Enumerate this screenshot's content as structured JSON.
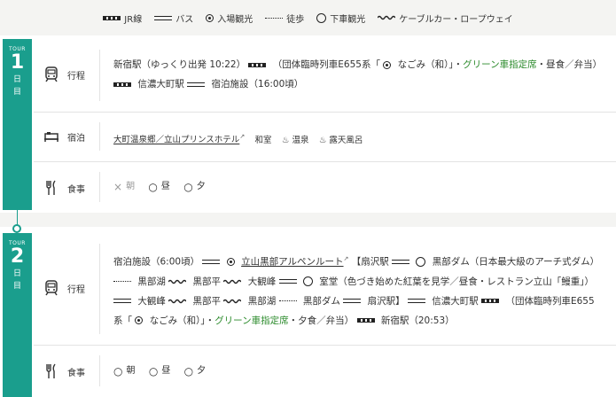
{
  "legend": [
    {
      "icon": "jr-line-icon",
      "label": "JR線"
    },
    {
      "icon": "bus-line-icon",
      "label": "バス"
    },
    {
      "icon": "entry-sightseeing-icon",
      "label": "入場観光"
    },
    {
      "icon": "walk-line-icon",
      "label": "徒歩"
    },
    {
      "icon": "stopover-sightseeing-icon",
      "label": "下車観光"
    },
    {
      "icon": "cable-car-icon",
      "label": "ケーブルカー・ロープウェイ"
    }
  ],
  "day1": {
    "tour": "TOUR",
    "num": "1",
    "ch1": "日",
    "ch2": "目",
    "itinerary": {
      "label": "行程",
      "t1": "新宿駅（ゆっくり出発 10:22）",
      "t2": "（団体臨時列車E655系「",
      "t3": "なごみ（和）」・",
      "t4": "グリーン車指定席",
      "t5": "・昼食／弁当）",
      "t6": "信濃大町駅",
      "t7": "宿泊施設（16:00頃）"
    },
    "lodging": {
      "label": "宿泊",
      "hotel": "大町温泉郷／立山プリンスホテル",
      "room": "和室",
      "onsen": "温泉",
      "outdoor": "露天風呂"
    },
    "meals": {
      "label": "食事",
      "breakfast": "朝",
      "lunch": "昼",
      "dinner": "夕",
      "breakfast_mark": "×",
      "lunch_mark": "○",
      "dinner_mark": "○"
    }
  },
  "day2": {
    "tour": "TOUR",
    "num": "2",
    "ch1": "日",
    "ch2": "目",
    "itinerary": {
      "label": "行程",
      "t1": "宿泊施設（6:00頃）",
      "t2": "立山黒部アルペンルート",
      "t3": "【扇沢駅",
      "t4": "黒部ダム（日本最大級のアーチ式ダム）",
      "t5": "黒部湖",
      "t6": "黒部平",
      "t7": "大観峰",
      "t8": "室堂（色づき始めた紅葉を見学／昼食・レストラン立山「鰻重」）",
      "t9": "大観峰",
      "t10": "黒部平",
      "t11": "黒部湖",
      "t12": "黒部ダム",
      "t13": "扇沢駅】",
      "t14": "信濃大町駅",
      "t15": "（団体臨時列車E655系「",
      "t16": "なごみ（和）」・",
      "t17": "グリーン車指定席",
      "t18": "・夕食／弁当）",
      "t19": "新宿駅（20:53）"
    },
    "meals": {
      "label": "食事",
      "breakfast": "朝",
      "lunch": "昼",
      "dinner": "夕",
      "breakfast_mark": "○",
      "lunch_mark": "○",
      "dinner_mark": "○"
    }
  },
  "colors": {
    "accent": "#1a9e8d",
    "green_text": "#2a8a2a",
    "band": "#f4f4f2"
  }
}
